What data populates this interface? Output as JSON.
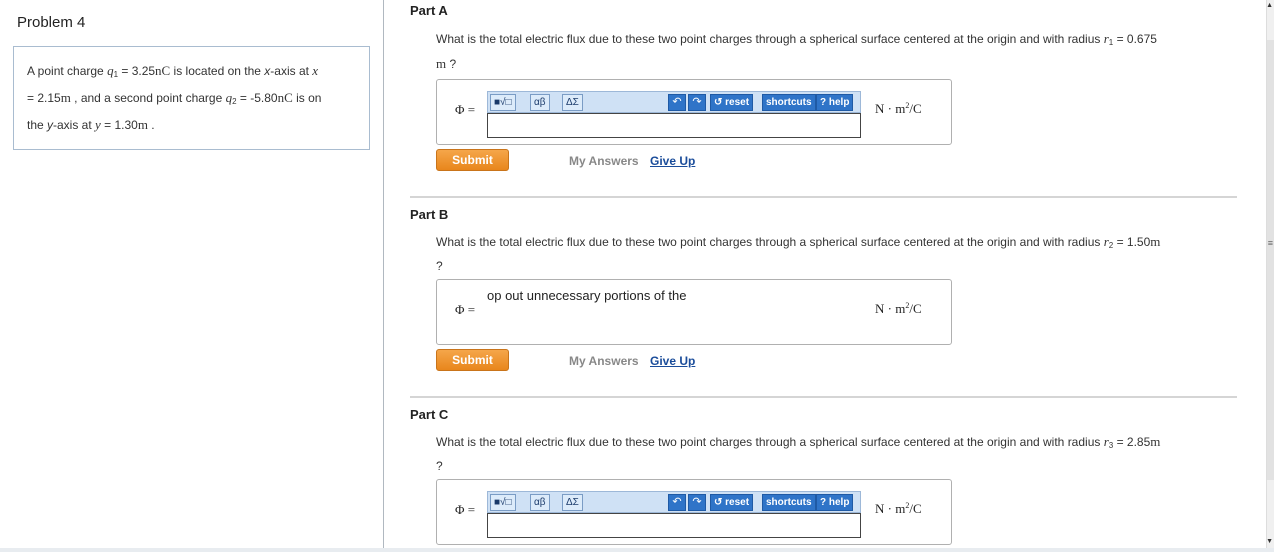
{
  "problem": {
    "title": "Problem 4",
    "text": {
      "l1a": "A point charge ",
      "q1": "q",
      "q1sub": "1",
      "l1b": " = 3.25",
      "nC1": "nC",
      "l1c": " is located on the ",
      "xaxis": "x",
      "l1d": "-axis at ",
      "xvar": "x",
      "l2a": "= 2.15",
      "m1": "m",
      "l2b": " , and a second point charge ",
      "q2": "q",
      "q2sub": "2",
      "l2c": " = -5.80",
      "nC2": "nC",
      "l2d": " is on",
      "l3a": "the ",
      "yaxis": "y",
      "l3b": "-axis at ",
      "yvar": "y",
      "l3c": " = 1.30",
      "m2": "m",
      "l3d": " ."
    }
  },
  "parts": [
    {
      "label": "Part A",
      "q_text": "What is the total electric flux due to these two point charges through a spherical surface centered at the origin and with radius ",
      "r": "r",
      "rsub": "1",
      "value": " = 0.675",
      "unit": "m",
      "tail": " ?",
      "phi": "Φ =",
      "units": "N · m",
      "units_sup": "2",
      "units_tail": "/C",
      "submit": "Submit",
      "my_answers": "My Answers",
      "give_up": "Give Up"
    },
    {
      "label": "Part B",
      "q_text": "What is the total electric flux due to these two point charges through a spherical surface centered at the origin and with radius ",
      "r": "r",
      "rsub": "2",
      "value": " = 1.50",
      "unit": "m",
      "tail": "?",
      "phi": "Φ =",
      "hint": "op out unnecessary portions of the",
      "units": "N · m",
      "units_sup": "2",
      "units_tail": "/C",
      "submit": "Submit",
      "my_answers": "My Answers",
      "give_up": "Give Up"
    },
    {
      "label": "Part C",
      "q_text": "What is the total electric flux due to these two point charges through a spherical surface centered at the origin and with radius ",
      "r": "r",
      "rsub": "3",
      "value": " = 2.85",
      "unit": "m",
      "tail": "?",
      "phi": "Φ =",
      "units": "N · m",
      "units_sup": "2",
      "units_tail": "/C"
    }
  ],
  "toolbar": {
    "templates": "■√□",
    "greek": "αβ",
    "symbols": "ΔΣ",
    "undo_icon": "↶",
    "redo_icon": "↷",
    "reset": "↺ reset",
    "shortcuts": "shortcuts",
    "help": "? help"
  },
  "scroll": {
    "mark": "≡",
    "up": "▲",
    "down": "▼"
  }
}
